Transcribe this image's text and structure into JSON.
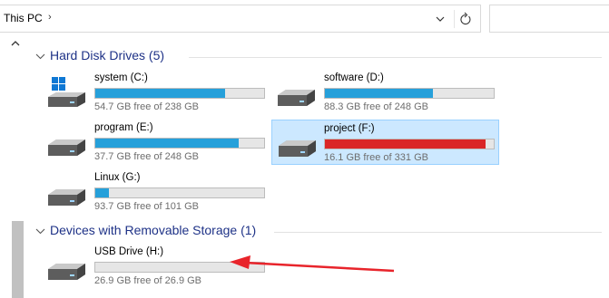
{
  "address": {
    "crumb": "This PC",
    "separator": "›"
  },
  "icons": {
    "dropdown": "chevron-down-icon",
    "refresh": "refresh-icon",
    "scroll_up": "scroll-up-icon"
  },
  "colors": {
    "bar_blue": "#26a0da",
    "bar_red": "#da2626",
    "selection": "#cce8ff",
    "group_title": "#1e3287",
    "arrow": "#e8242b"
  },
  "groups": [
    {
      "title": "Hard Disk Drives (5)",
      "drives": [
        {
          "name": "system (C:)",
          "free": "54.7 GB free of 238 GB",
          "used_fraction": 0.77,
          "bar_color": "blue",
          "icon": "windows-drive-icon",
          "selected": false
        },
        {
          "name": "software (D:)",
          "free": "88.3 GB free of 248 GB",
          "used_fraction": 0.64,
          "bar_color": "blue",
          "icon": "drive-icon",
          "selected": false
        },
        {
          "name": "program (E:)",
          "free": "37.7 GB free of 248 GB",
          "used_fraction": 0.85,
          "bar_color": "blue",
          "icon": "drive-icon",
          "selected": false
        },
        {
          "name": "project (F:)",
          "free": "16.1 GB free of 331 GB",
          "used_fraction": 0.95,
          "bar_color": "red",
          "icon": "drive-icon",
          "selected": true
        },
        {
          "name": "Linux (G:)",
          "free": "93.7 GB free of 101 GB",
          "used_fraction": 0.08,
          "bar_color": "blue",
          "icon": "drive-icon",
          "selected": false
        }
      ]
    },
    {
      "title": "Devices with Removable Storage (1)",
      "drives": [
        {
          "name": "USB Drive (H:)",
          "free": "26.9 GB free of 26.9 GB",
          "used_fraction": 0.0,
          "bar_color": "blue",
          "icon": "usb-drive-icon",
          "selected": false
        }
      ]
    }
  ]
}
